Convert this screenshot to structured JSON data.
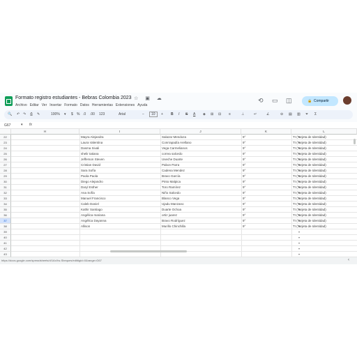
{
  "document": {
    "title": "Formato registro estudiantes - Bebras Colombia 2023",
    "title_icons": "☆ ▣ ☁"
  },
  "menu": [
    "Archivo",
    "Editar",
    "Ver",
    "Insertar",
    "Formato",
    "Datos",
    "Herramientas",
    "Extensiones",
    "Ayuda"
  ],
  "header_icons": {
    "history": "history-icon",
    "comments": "comment-icon",
    "meet": "video-call-icon"
  },
  "share": {
    "label": "Compartir",
    "lock": "🔒"
  },
  "toolbar": {
    "search": "🔍",
    "undo": "↶",
    "redo": "↷",
    "print": "⎙",
    "paint_format": "✎",
    "zoom": "100%",
    "currency": "$",
    "percent": "%",
    "dec_decrease": ".0",
    "dec_increase": ".00",
    "number_format": "123",
    "font": "Arial",
    "font_minus": "−",
    "font_size": "10",
    "font_plus": "+",
    "bold": "B",
    "italic": "I",
    "strike": "S",
    "text_color": "A",
    "fill": "◈",
    "borders": "⊞",
    "merge": "⊟",
    "align": "≡",
    "valign": "⊥",
    "wrap": "↵",
    "rotate": "∠",
    "link": "⊖",
    "comment": "▤",
    "chart": "▥",
    "filter": "⏷",
    "functions": "Σ"
  },
  "formula_bar": {
    "name_box": "G67",
    "fx": "fx",
    "value": ""
  },
  "columns": [
    "H",
    "I",
    "J",
    "K",
    "L"
  ],
  "rows": [
    {
      "num": "22",
      "name": "Mayra Alejandra",
      "surname": "Salazar Mendoza",
      "grade": "9°",
      "doc": "TI (Tarjeta de Identidad)"
    },
    {
      "num": "23",
      "name": "Laura Valentina",
      "surname": "Conrrapadía Arellano",
      "grade": "9°",
      "doc": "TI (Tarjeta de Identidad)"
    },
    {
      "num": "24",
      "name": "Dasma Sivali",
      "surname": "Vega Carmelianos",
      "grade": "9°",
      "doc": "TI (Tarjeta de Identidad)"
    },
    {
      "num": "25",
      "name": "shelir tatiana",
      "surname": "correa salcedo",
      "grade": "9°",
      "doc": "TI (Tarjeta de Identidad)"
    },
    {
      "num": "26",
      "name": "Jefferson Steven",
      "surname": "Useche Duarte",
      "grade": "9°",
      "doc": "TI (Tarjeta de Identidad)"
    },
    {
      "num": "27",
      "name": "Cristian David",
      "surname": "Pabon Parra",
      "grade": "9°",
      "doc": "TI (Tarjeta de Identidad)"
    },
    {
      "num": "28",
      "name": "Sara Sofía",
      "surname": "Cadena Mendez",
      "grade": "9°",
      "doc": "TI (Tarjeta de Identidad)"
    },
    {
      "num": "29",
      "name": "Paola Paola",
      "surname": "Bravo García",
      "grade": "9°",
      "doc": "TI (Tarjeta de Identidad)"
    },
    {
      "num": "30",
      "name": "Diego Alejandro",
      "surname": "Pinto Malpica",
      "grade": "9°",
      "doc": "TI (Tarjeta de Identidad)"
    },
    {
      "num": "31",
      "name": "Daryl Esther",
      "surname": "Toro Ramírez",
      "grade": "9°",
      "doc": "TI (Tarjeta de Identidad)"
    },
    {
      "num": "32",
      "name": "Ana Sofía",
      "surname": "Niño Salcedo",
      "grade": "9°",
      "doc": "TI (Tarjeta de Identidad)"
    },
    {
      "num": "33",
      "name": "Manuel Francisco",
      "surname": "Blanco Vega",
      "grade": "9°",
      "doc": "TI (Tarjeta de Identidad)"
    },
    {
      "num": "34",
      "name": "Caleb Daniel",
      "surname": "Ujadu Manzano",
      "grade": "9°",
      "doc": "TI (Tarjeta de Identidad)"
    },
    {
      "num": "35",
      "name": "Kathir Santiago",
      "surname": "Duarte Ochoa",
      "grade": "9°",
      "doc": "TI (Tarjeta de Identidad)"
    },
    {
      "num": "36",
      "name": "Angélica mariana",
      "surname": "ortiz juarez",
      "grade": "9°",
      "doc": "TI (Tarjeta de Identidad)"
    },
    {
      "num": "37",
      "name": "Angélica Dayanna",
      "surname": "Bravo Rodríguez",
      "grade": "9°",
      "doc": "TI (Tarjeta de Identidad)"
    },
    {
      "num": "38",
      "name": "Allison",
      "surname": "Murillo Chinchilla",
      "grade": "9°",
      "doc": "TI (Tarjeta de Identidad)"
    },
    {
      "num": "39",
      "name": "",
      "surname": "",
      "grade": "",
      "doc": ""
    },
    {
      "num": "40",
      "name": "",
      "surname": "",
      "grade": "",
      "doc": ""
    },
    {
      "num": "41",
      "name": "",
      "surname": "",
      "grade": "",
      "doc": ""
    },
    {
      "num": "42",
      "name": "",
      "surname": "",
      "grade": "",
      "doc": ""
    },
    {
      "num": "43",
      "name": "",
      "surname": "",
      "grade": "",
      "doc": ""
    }
  ],
  "selected_row": "37",
  "status_bar": {
    "url": "https://docs.google.com/spreadsheets/d/1AxXw-Sbeques/edit#gid=0&range=G67"
  }
}
